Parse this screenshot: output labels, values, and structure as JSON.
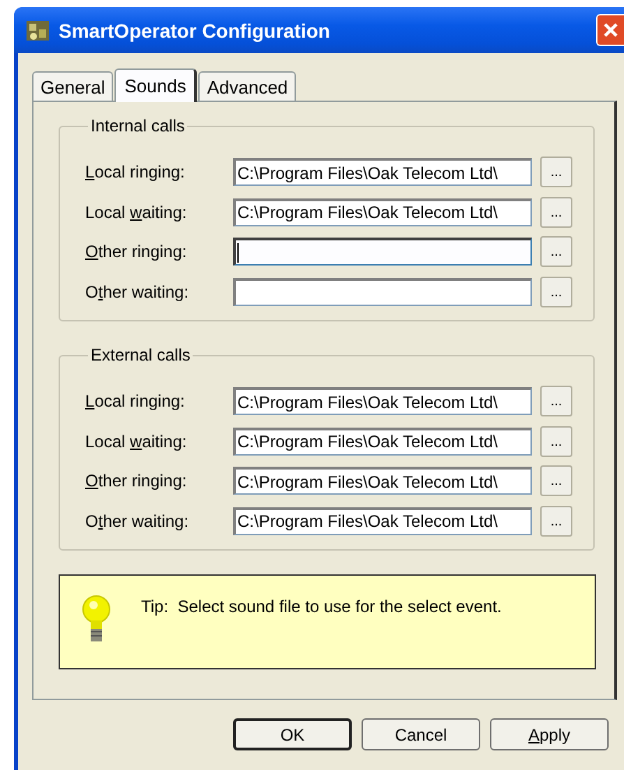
{
  "window": {
    "title": "SmartOperator Configuration"
  },
  "tabs": [
    {
      "label": "General",
      "selected": false
    },
    {
      "label": "Sounds",
      "selected": true
    },
    {
      "label": "Advanced",
      "selected": false
    }
  ],
  "groups": [
    {
      "title": "Internal calls",
      "rows": [
        {
          "label": {
            "key": "L",
            "after": "ocal ringing:"
          },
          "value": "C:\\Program Files\\Oak Telecom Ltd\\",
          "focused": false,
          "browse": "..."
        },
        {
          "label": {
            "before": "Local ",
            "key": "w",
            "after": "aiting:"
          },
          "value": "C:\\Program Files\\Oak Telecom Ltd\\",
          "focused": false,
          "browse": "..."
        },
        {
          "label": {
            "key": "O",
            "after": "ther ringing:"
          },
          "focused": true,
          "browse": "..."
        },
        {
          "label": {
            "before": "O",
            "key": "t",
            "after": "her waiting:"
          },
          "focused": false,
          "browse": "..."
        }
      ]
    },
    {
      "title": "External calls",
      "rows": [
        {
          "label": {
            "key": "L",
            "after": "ocal ringing:"
          },
          "value": "C:\\Program Files\\Oak Telecom Ltd\\",
          "focused": false,
          "browse": "..."
        },
        {
          "label": {
            "before": "Local ",
            "key": "w",
            "after": "aiting:"
          },
          "value": "C:\\Program Files\\Oak Telecom Ltd\\",
          "focused": false,
          "browse": "..."
        },
        {
          "label": {
            "key": "O",
            "after": "ther ringing:"
          },
          "value": "C:\\Program Files\\Oak Telecom Ltd\\",
          "focused": false,
          "browse": "..."
        },
        {
          "label": {
            "before": "O",
            "key": "t",
            "after": "her waiting:"
          },
          "value": "C:\\Program Files\\Oak Telecom Ltd\\",
          "focused": false,
          "browse": "..."
        }
      ]
    }
  ],
  "tip": "Tip:  Select sound file to use for the select event.",
  "buttons": [
    {
      "label": {
        "after": "OK"
      },
      "default": true
    },
    {
      "label": {
        "after": "Cancel"
      },
      "default": false
    },
    {
      "label": {
        "key": "A",
        "after": "pply"
      },
      "default": false
    }
  ]
}
